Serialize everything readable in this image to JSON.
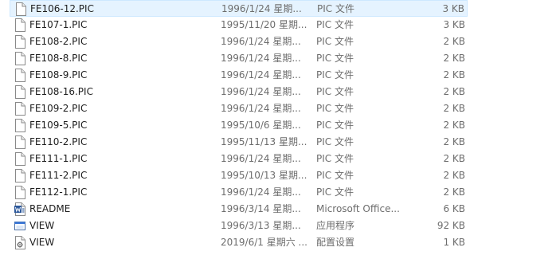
{
  "files": [
    {
      "name": "FE106-12.PIC",
      "date": "1996/1/24 星期...",
      "type": "PIC 文件",
      "size": "3 KB",
      "icon": "file-icon",
      "selected": true
    },
    {
      "name": "FE107-1.PIC",
      "date": "1995/11/20 星期...",
      "type": "PIC 文件",
      "size": "3 KB",
      "icon": "file-icon"
    },
    {
      "name": "FE108-2.PIC",
      "date": "1996/1/24 星期...",
      "type": "PIC 文件",
      "size": "2 KB",
      "icon": "file-icon"
    },
    {
      "name": "FE108-8.PIC",
      "date": "1996/1/24 星期...",
      "type": "PIC 文件",
      "size": "2 KB",
      "icon": "file-icon"
    },
    {
      "name": "FE108-9.PIC",
      "date": "1996/1/24 星期...",
      "type": "PIC 文件",
      "size": "2 KB",
      "icon": "file-icon"
    },
    {
      "name": "FE108-16.PIC",
      "date": "1996/1/24 星期...",
      "type": "PIC 文件",
      "size": "2 KB",
      "icon": "file-icon"
    },
    {
      "name": "FE109-2.PIC",
      "date": "1996/1/24 星期...",
      "type": "PIC 文件",
      "size": "2 KB",
      "icon": "file-icon"
    },
    {
      "name": "FE109-5.PIC",
      "date": "1995/10/6 星期...",
      "type": "PIC 文件",
      "size": "2 KB",
      "icon": "file-icon"
    },
    {
      "name": "FE110-2.PIC",
      "date": "1995/11/13 星期...",
      "type": "PIC 文件",
      "size": "2 KB",
      "icon": "file-icon"
    },
    {
      "name": "FE111-1.PIC",
      "date": "1996/1/24 星期...",
      "type": "PIC 文件",
      "size": "2 KB",
      "icon": "file-icon"
    },
    {
      "name": "FE111-2.PIC",
      "date": "1995/10/13 星期...",
      "type": "PIC 文件",
      "size": "2 KB",
      "icon": "file-icon"
    },
    {
      "name": "FE112-1.PIC",
      "date": "1996/1/24 星期...",
      "type": "PIC 文件",
      "size": "2 KB",
      "icon": "file-icon"
    },
    {
      "name": "README",
      "date": "1996/3/14 星期...",
      "type": "Microsoft Office...",
      "size": "6 KB",
      "icon": "word-doc-icon"
    },
    {
      "name": "VIEW",
      "date": "1996/3/13 星期...",
      "type": "应用程序",
      "size": "92 KB",
      "icon": "application-icon"
    },
    {
      "name": "VIEW",
      "date": "2019/6/1 星期六 ...",
      "type": "配置设置",
      "size": "1 KB",
      "icon": "config-settings-icon"
    }
  ],
  "colors": {
    "selection_bg": "#e5f3ff",
    "selection_border": "#cde8ff",
    "word_blue": "#2b579a",
    "secondary_text": "#6d6d6d"
  }
}
